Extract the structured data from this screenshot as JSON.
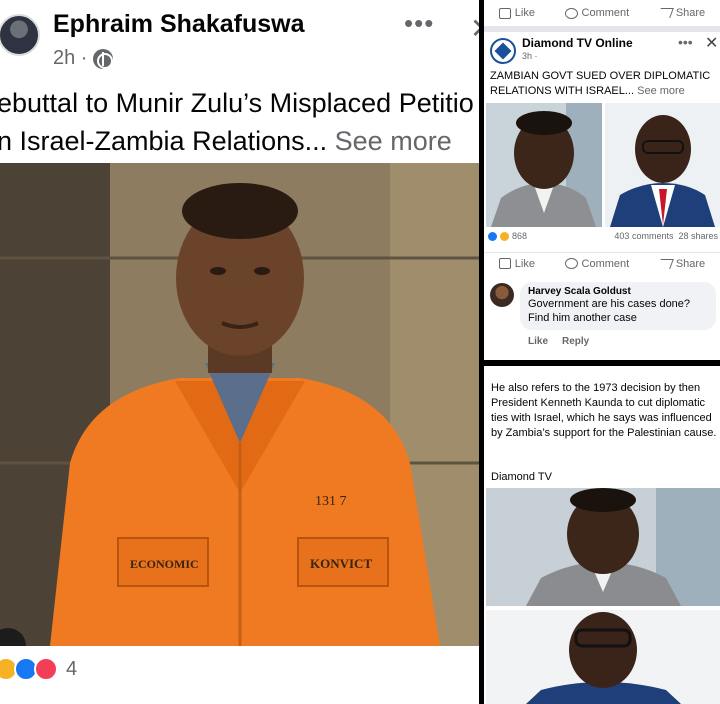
{
  "left_post": {
    "author": "Ephraim Shakafuswa",
    "time": "2h ·",
    "text_line1": "ebuttal to Munir Zulu’s Misplaced Petitio",
    "text_line2": "n Israel-Zambia Relations...",
    "see_more": "See more",
    "more_icon": "•••",
    "close_icon": "✕",
    "photo": {
      "number_tag": "131 7",
      "left_patch": "ECONOMIC",
      "right_patch": "KONVICT"
    },
    "reaction_count": "4"
  },
  "diamond_post": {
    "actions_top": {
      "like": "Like",
      "comment": "Comment",
      "share": "Share"
    },
    "page_name": "Diamond TV Online",
    "time": "3h ·",
    "more_icon": "•••",
    "close_icon": "✕",
    "headline": "ZAMBIAN GOVT SUED OVER DIPLOMATIC RELATIONS WITH ISRAEL...",
    "see_more": "See more",
    "reaction_count": "868",
    "comments": "403 comments",
    "shares": "28 shares",
    "actions_bottom": {
      "like": "Like",
      "comment": "Comment",
      "share": "Share"
    },
    "comment": {
      "author": "Harvey Scala Goldust",
      "text": "Government are his cases done? Find him another case",
      "like": "Like",
      "reply": "Reply"
    }
  },
  "article": {
    "body": "He also refers to the 1973 decision by then President Kenneth Kaunda to cut diplomatic ties with Israel, which he says was influenced by Zambia’s support for the Palestinian cause.",
    "source": "Diamond TV"
  },
  "colors": {
    "facebook_blue": "#1877f2",
    "orange_suit": "#f07a22",
    "text_grey": "#65676b"
  }
}
